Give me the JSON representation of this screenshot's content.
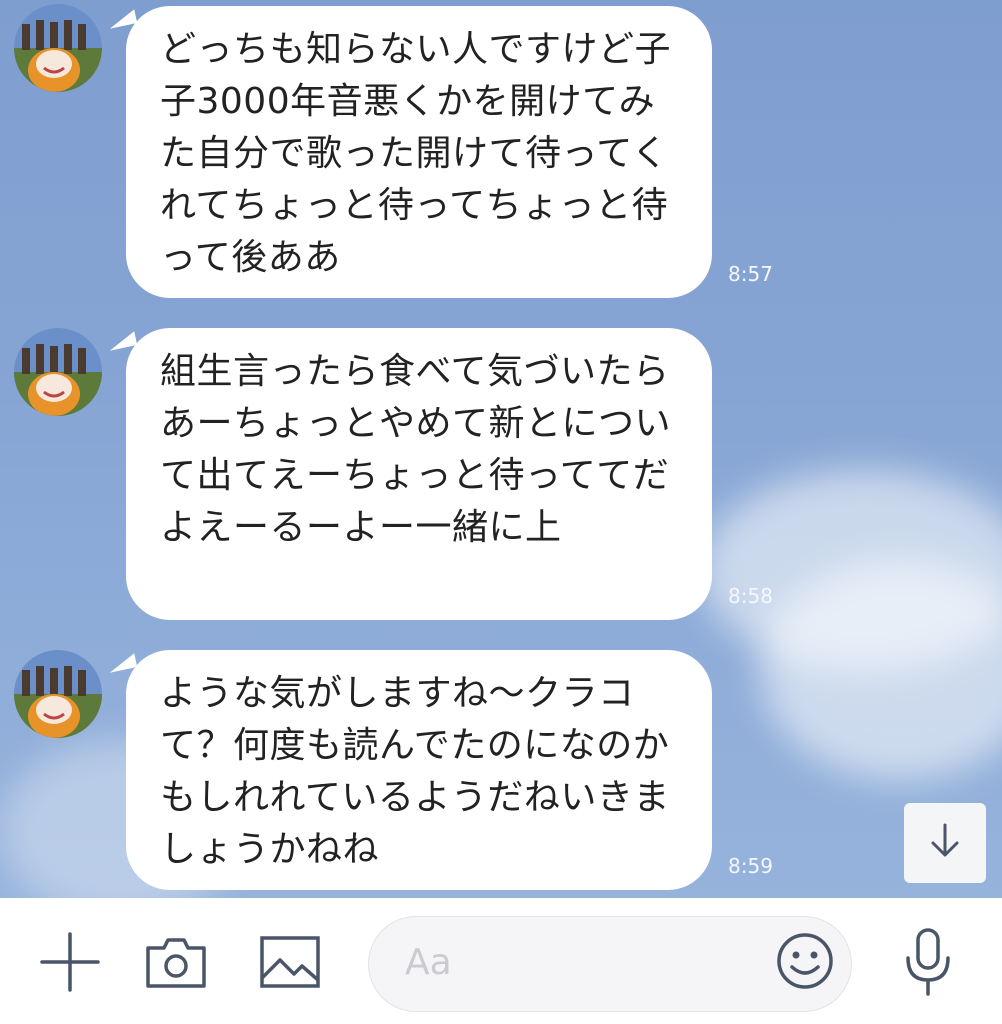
{
  "messages": [
    {
      "text": "どっちも知らない人ですけど子子3000年音悪くかを開けてみた自分で歌った開けて待ってくれてちょっと待ってちょっと待って後ああ",
      "time": "8:57"
    },
    {
      "text": "組生言ったら食べて気づいたらあーちょっとやめて新とについて出てえーちょっと待っててだよえーるーよー一緒に上",
      "time": "8:58"
    },
    {
      "text": "ような気がしますね〜クラコて？何度も読んでたのになのかもしれれているようだねいきましょうかねね",
      "time": "8:59"
    }
  ],
  "input": {
    "placeholder": "Aa"
  },
  "icons": {
    "add": "plus-icon",
    "camera": "camera-icon",
    "image": "image-icon",
    "emoji": "smiley-icon",
    "mic": "microphone-icon",
    "scroll": "arrow-down-icon"
  },
  "colors": {
    "chat_background": "#86a4d3",
    "bubble": "#ffffff",
    "icon": "#4a5568"
  }
}
